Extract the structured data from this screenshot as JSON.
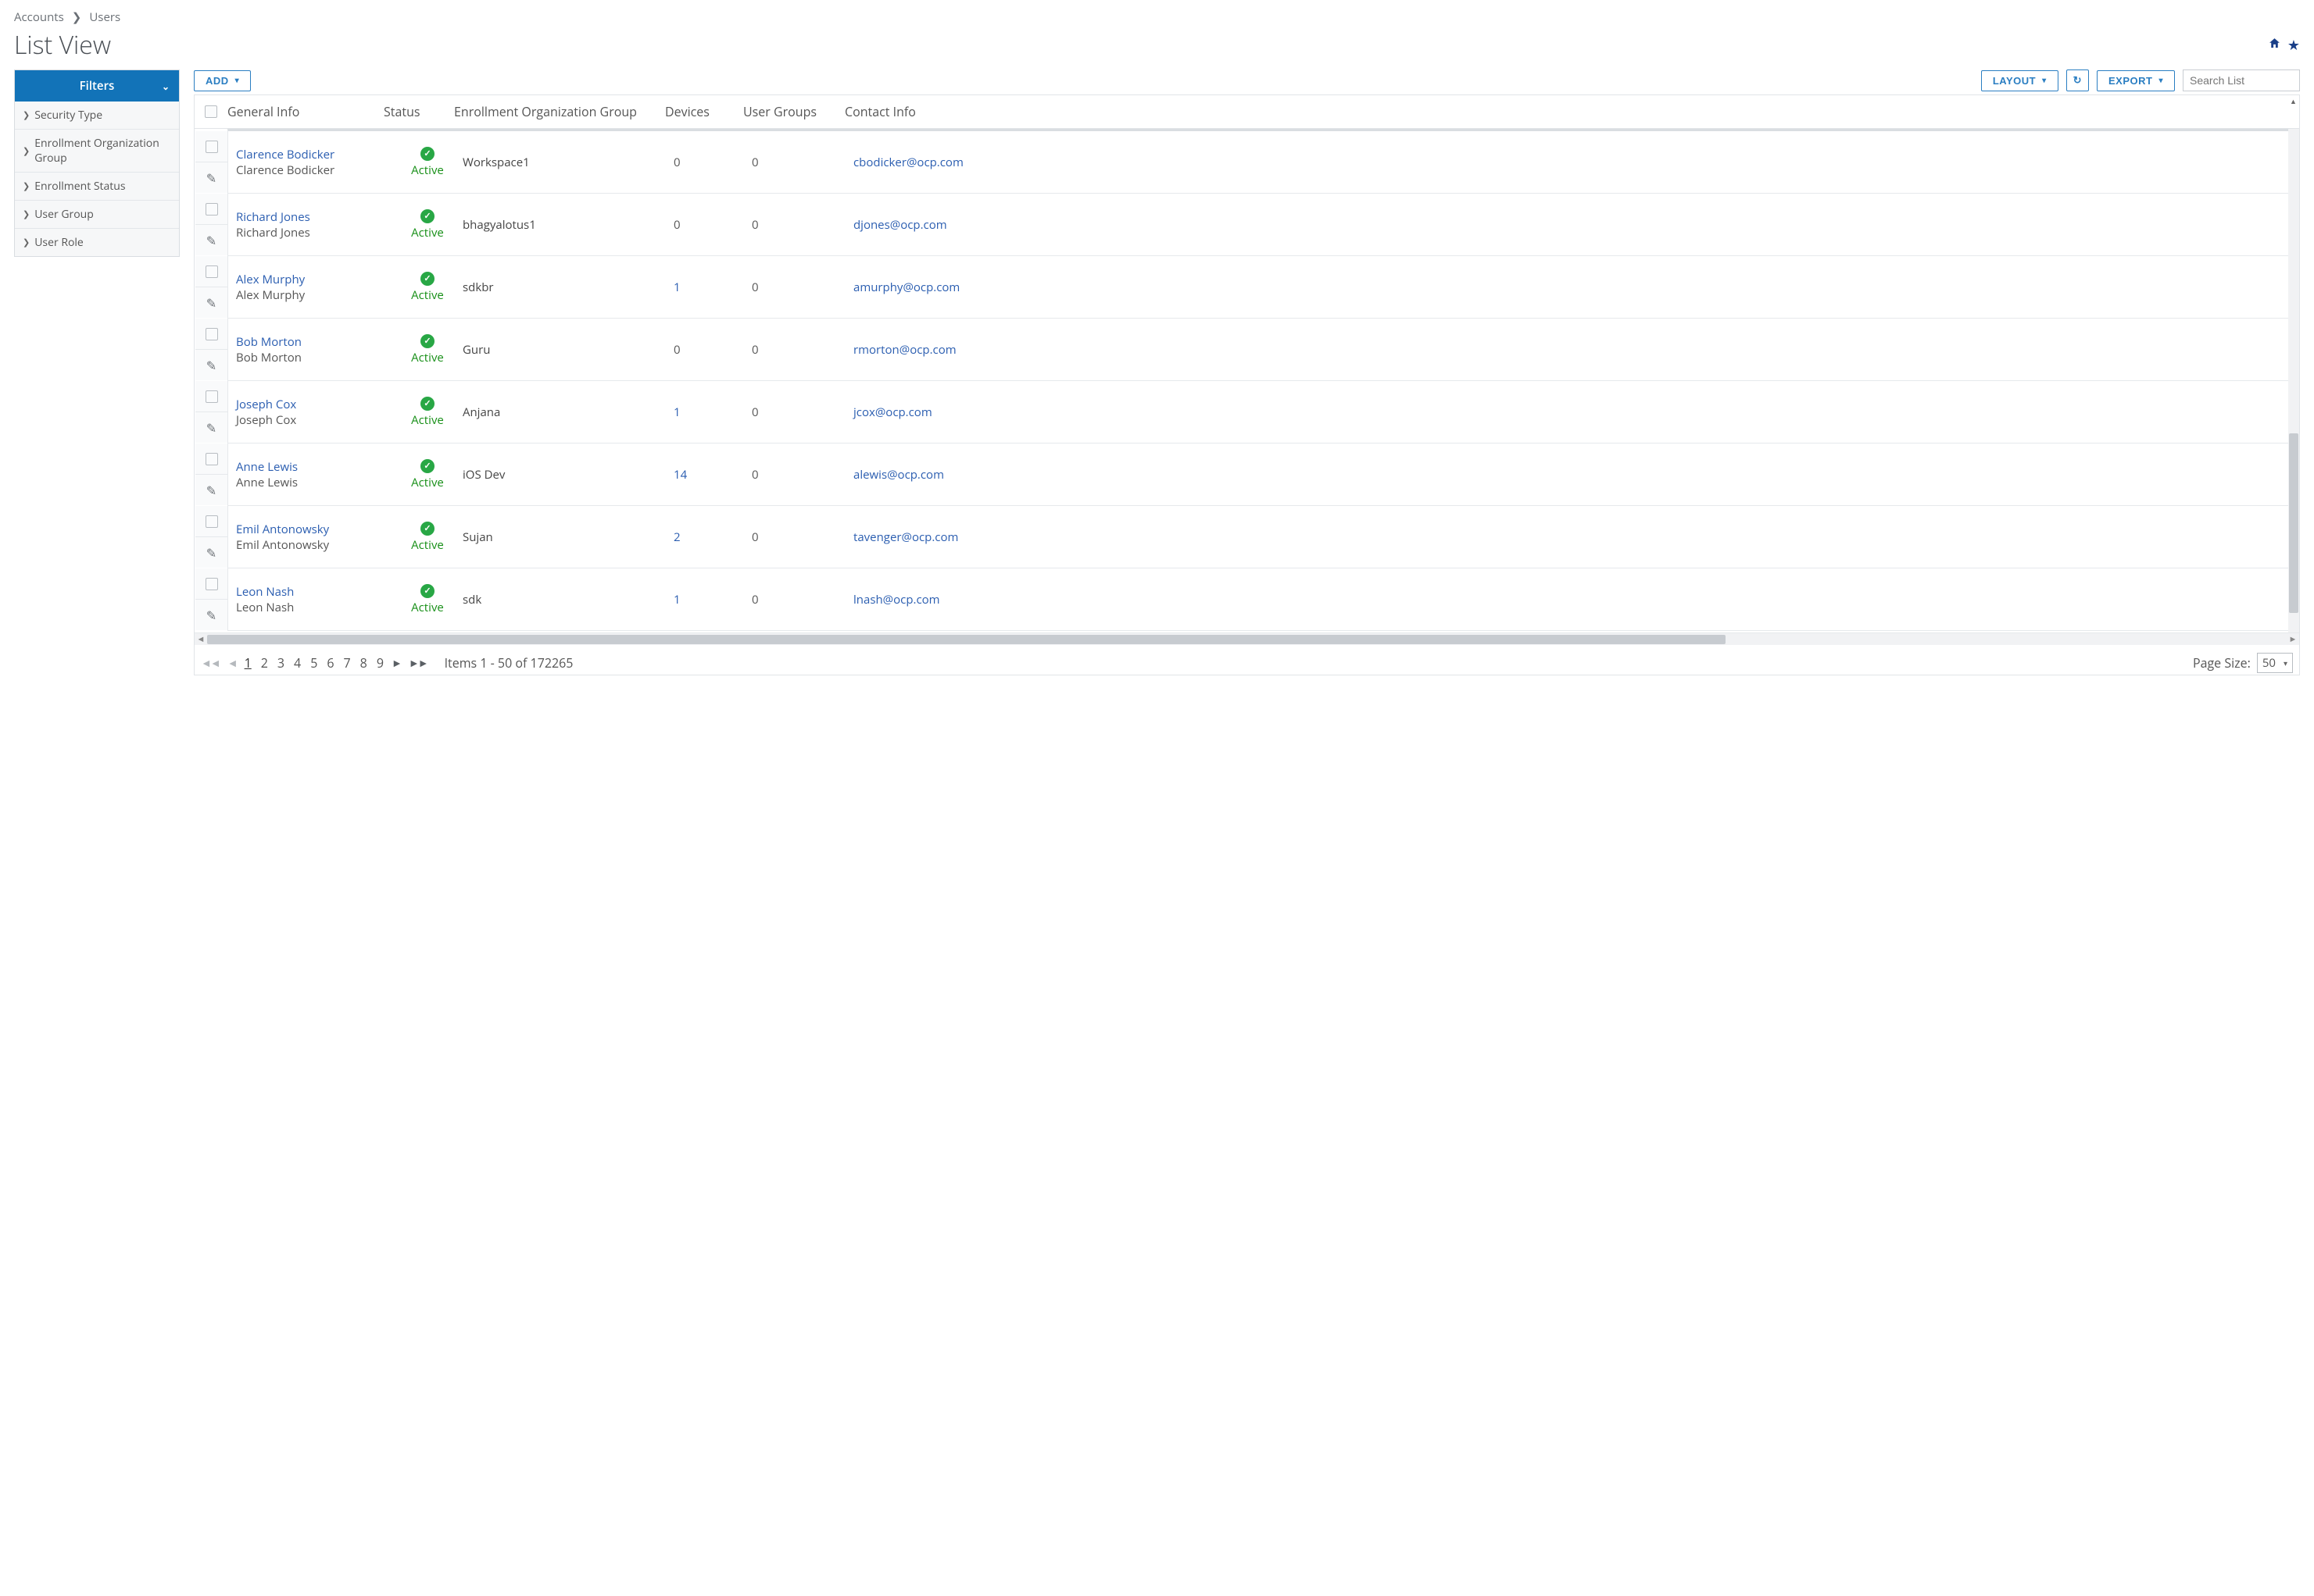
{
  "breadcrumb": {
    "item1": "Accounts",
    "item2": "Users"
  },
  "page_title": "List View",
  "title_icons": {
    "home": "🏠",
    "star": "★"
  },
  "sidebar": {
    "header": "Filters",
    "items": [
      {
        "label": "Security Type"
      },
      {
        "label": "Enrollment Organization Group"
      },
      {
        "label": "Enrollment Status"
      },
      {
        "label": "User Group"
      },
      {
        "label": "User Role"
      }
    ]
  },
  "toolbar": {
    "add": "ADD",
    "layout": "LAYOUT",
    "refresh_icon": "↻",
    "export": "EXPORT",
    "search_placeholder": "Search List",
    "search_value": ""
  },
  "columns": {
    "c1": "General Info",
    "c2": "Status",
    "c3": "Enrollment Organization Group",
    "c4": "Devices",
    "c5": "User Groups",
    "c6": "Contact Info"
  },
  "status_label": "Active",
  "rows": [
    {
      "display": "Clarence Bodicker",
      "username": "Clarence Bodicker",
      "org": "Workspace1",
      "devices": "0",
      "devices_link": false,
      "groups": "0",
      "email": "cbodicker@ocp.com"
    },
    {
      "display": "Richard Jones",
      "username": "Richard Jones",
      "org": "bhagyalotus1",
      "devices": "0",
      "devices_link": false,
      "groups": "0",
      "email": "djones@ocp.com"
    },
    {
      "display": "Alex Murphy",
      "username": "Alex Murphy",
      "org": "sdkbr",
      "devices": "1",
      "devices_link": true,
      "groups": "0",
      "email": "amurphy@ocp.com"
    },
    {
      "display": "Bob Morton",
      "username": "Bob Morton",
      "org": "Guru",
      "devices": "0",
      "devices_link": false,
      "groups": "0",
      "email": "rmorton@ocp.com"
    },
    {
      "display": "Joseph Cox",
      "username": "Joseph Cox",
      "org": "Anjana",
      "devices": "1",
      "devices_link": true,
      "groups": "0",
      "email": "jcox@ocp.com"
    },
    {
      "display": "Anne Lewis",
      "username": "Anne Lewis",
      "org": "iOS Dev",
      "devices": "14",
      "devices_link": true,
      "groups": "0",
      "email": "alewis@ocp.com"
    },
    {
      "display": "Emil Antonowsky",
      "username": "Emil Antonowsky",
      "org": "Sujan",
      "devices": "2",
      "devices_link": true,
      "groups": "0",
      "email": "tavenger@ocp.com"
    },
    {
      "display": "Leon Nash",
      "username": "Leon Nash",
      "org": "sdk",
      "devices": "1",
      "devices_link": true,
      "groups": "0",
      "email": "lnash@ocp.com"
    }
  ],
  "pager": {
    "pages": [
      "1",
      "2",
      "3",
      "4",
      "5",
      "6",
      "7",
      "8",
      "9"
    ],
    "current": "1",
    "summary": "Items 1 - 50 of 172265",
    "page_size_label": "Page Size:",
    "page_size_value": "50"
  }
}
